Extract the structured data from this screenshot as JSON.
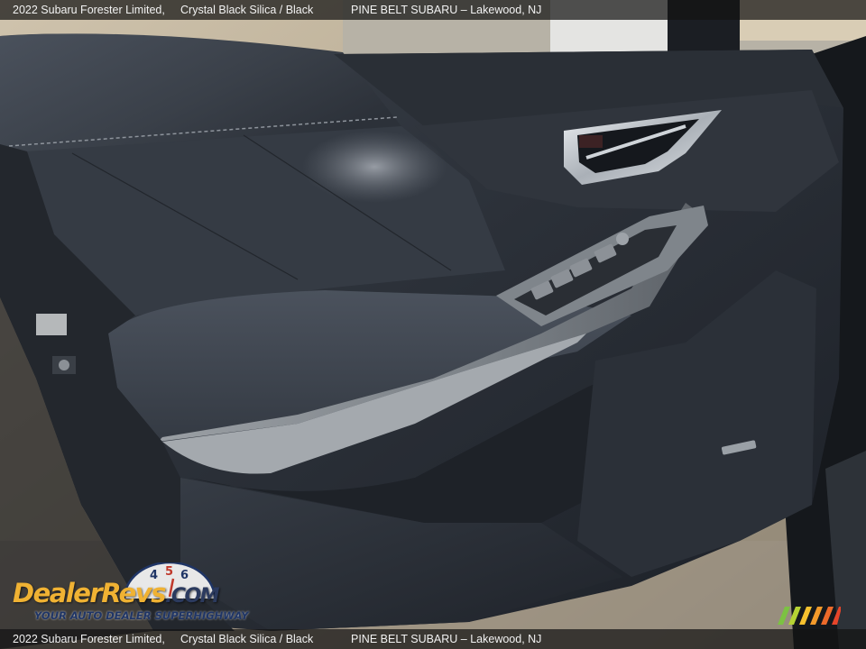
{
  "caption": {
    "title": "2022 Subaru Forester Limited,",
    "color": "Crystal Black Silica / Black",
    "dealer": "PINE BELT SUBARU – Lakewood, NJ"
  },
  "watermark": {
    "brand_dealer": "Dealer",
    "brand_revs": "Revs",
    "brand_com": ".COM",
    "tagline": "YOUR AUTO DEALER SUPERHIGHWAY",
    "gauge_digits": [
      "4",
      "5",
      "6"
    ]
  },
  "photo": {
    "subject": "door-panel",
    "colors": {
      "panel": "#2b3038",
      "trim": "#8c9196",
      "chrome": "#c9ced4",
      "background": "#b9a88e"
    }
  }
}
